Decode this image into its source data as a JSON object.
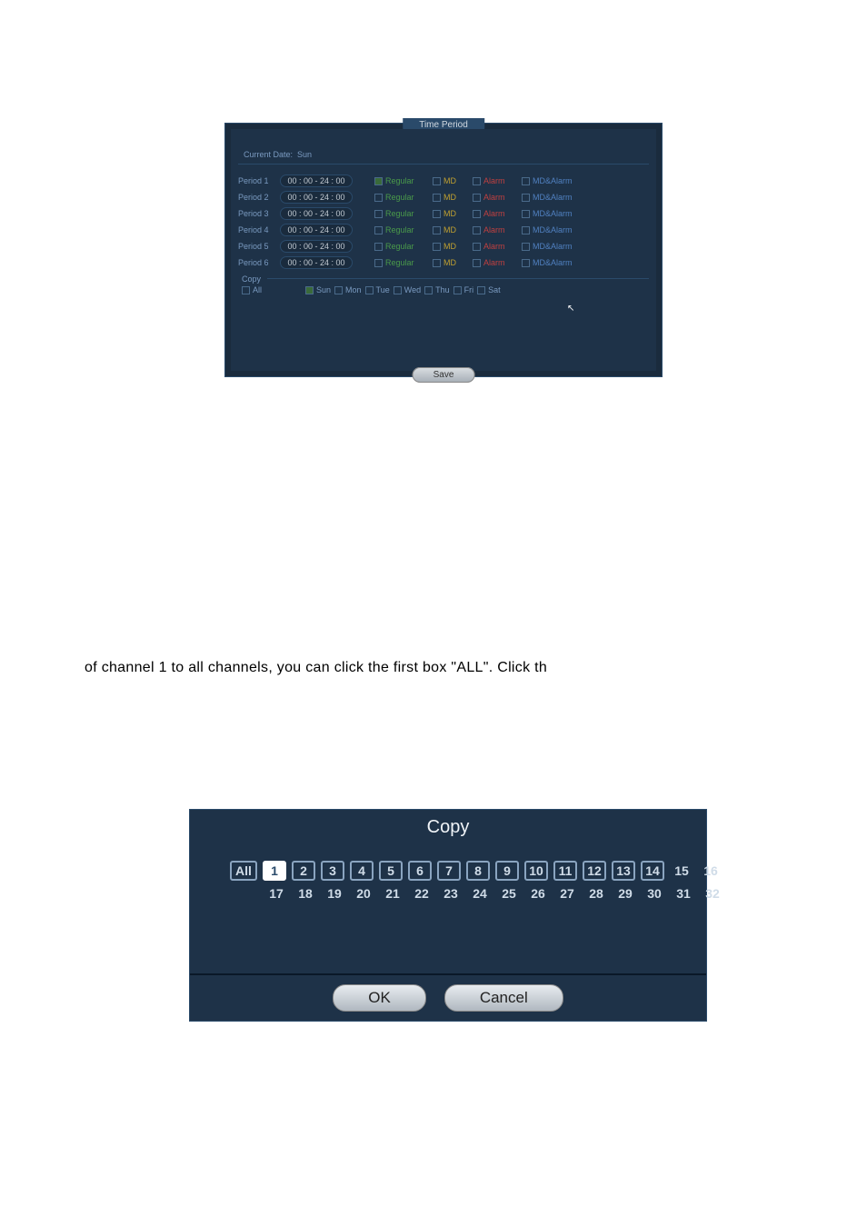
{
  "dialog1": {
    "title": "Time Period",
    "current_date_label": "Current Date:",
    "current_date_value": "Sun",
    "periods": [
      {
        "label": "Period 1",
        "time": "00 : 00    - 24 : 00",
        "reg_checked": true
      },
      {
        "label": "Period 2",
        "time": "00 : 00    - 24 : 00",
        "reg_checked": false
      },
      {
        "label": "Period 3",
        "time": "00 : 00    - 24 : 00",
        "reg_checked": false
      },
      {
        "label": "Period 4",
        "time": "00 : 00    - 24 : 00",
        "reg_checked": false
      },
      {
        "label": "Period 5",
        "time": "00 : 00    - 24 : 00",
        "reg_checked": false
      },
      {
        "label": "Period 6",
        "time": "00 : 00    - 24 : 00",
        "reg_checked": false
      }
    ],
    "col_regular": "Regular",
    "col_md": "MD",
    "col_alarm": "Alarm",
    "col_mdalarm": "MD&Alarm",
    "copy_label": "Copy",
    "all_label": "All",
    "days": [
      "Sun",
      "Mon",
      "Tue",
      "Wed",
      "Thu",
      "Fri",
      "Sat"
    ],
    "save_label": "Save"
  },
  "text_line": "of channel 1 to all channels, you can click the first box \"ALL\". Click th",
  "dialog2": {
    "title": "Copy",
    "all_label": "All",
    "row1": [
      "1",
      "2",
      "3",
      "4",
      "5",
      "6",
      "7",
      "8",
      "9",
      "10",
      "11",
      "12",
      "13",
      "14",
      "15",
      "16"
    ],
    "row2": [
      "17",
      "18",
      "19",
      "20",
      "21",
      "22",
      "23",
      "24",
      "25",
      "26",
      "27",
      "28",
      "29",
      "30",
      "31",
      "32"
    ],
    "ok_label": "OK",
    "cancel_label": "Cancel"
  }
}
